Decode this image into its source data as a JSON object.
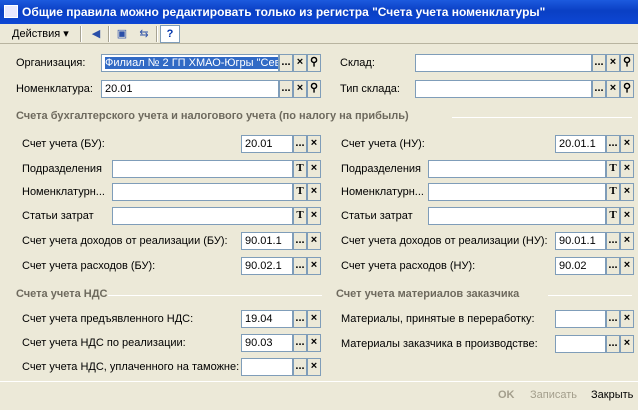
{
  "window": {
    "title": "Общие правила можно редактировать только из регистра \"Счета учета номенклатуры\""
  },
  "toolbar": {
    "actions_label": "Действия",
    "help": "?"
  },
  "top": {
    "org_label": "Организация:",
    "org_value": "Филиал № 2 ГП ХМАО-Югры \"Сев",
    "nom_label": "Номенклатура:",
    "nom_value": "20.01",
    "warehouse_label": "Склад:",
    "warehouse_value": "",
    "whtype_label": "Тип склада:",
    "whtype_value": ""
  },
  "groups": {
    "acc": "Счета бухгалтерского учета и налогового учета (по налогу на прибыль)",
    "vat": "Счета учета НДС",
    "cust": "Счет учета материалов заказчика"
  },
  "bu": {
    "acc_label": "Счет учета (БУ):",
    "acc_value": "20.01",
    "dept_label": "Подразделения",
    "dept_value": "",
    "nom_label": "Номенклатурн...",
    "nom_value": "",
    "cost_label": "Статьи затрат",
    "cost_value": "",
    "inc_label": "Счет учета доходов от реализации (БУ):",
    "inc_value": "90.01.1",
    "exp_label": "Счет учета расходов (БУ):",
    "exp_value": "90.02.1"
  },
  "nu": {
    "acc_label": "Счет учета (НУ):",
    "acc_value": "20.01.1",
    "dept_label": "Подразделения",
    "dept_value": "",
    "nom_label": "Номенклатурн...",
    "nom_value": "",
    "cost_label": "Статьи затрат",
    "cost_value": "",
    "inc_label": "Счет учета доходов от реализации (НУ):",
    "inc_value": "90.01.1",
    "exp_label": "Счет учета расходов (НУ):",
    "exp_value": "90.02"
  },
  "vat": {
    "pres_label": "Счет учета предъявленного НДС:",
    "pres_value": "19.04",
    "sale_label": "Счет учета НДС по реализации:",
    "sale_value": "90.03",
    "cust_label": "Счет учета НДС, уплаченного на таможне:",
    "cust_value": ""
  },
  "cust": {
    "proc_label": "Материалы, принятые в переработку:",
    "proc_value": "",
    "prod_label": "Материалы заказчика в производстве:",
    "prod_value": ""
  },
  "buttons": {
    "ok": "OK",
    "save": "Записать",
    "close": "Закрыть"
  },
  "icons": {
    "select": "...",
    "clear": "×",
    "search": "magnifier",
    "text": "T"
  }
}
